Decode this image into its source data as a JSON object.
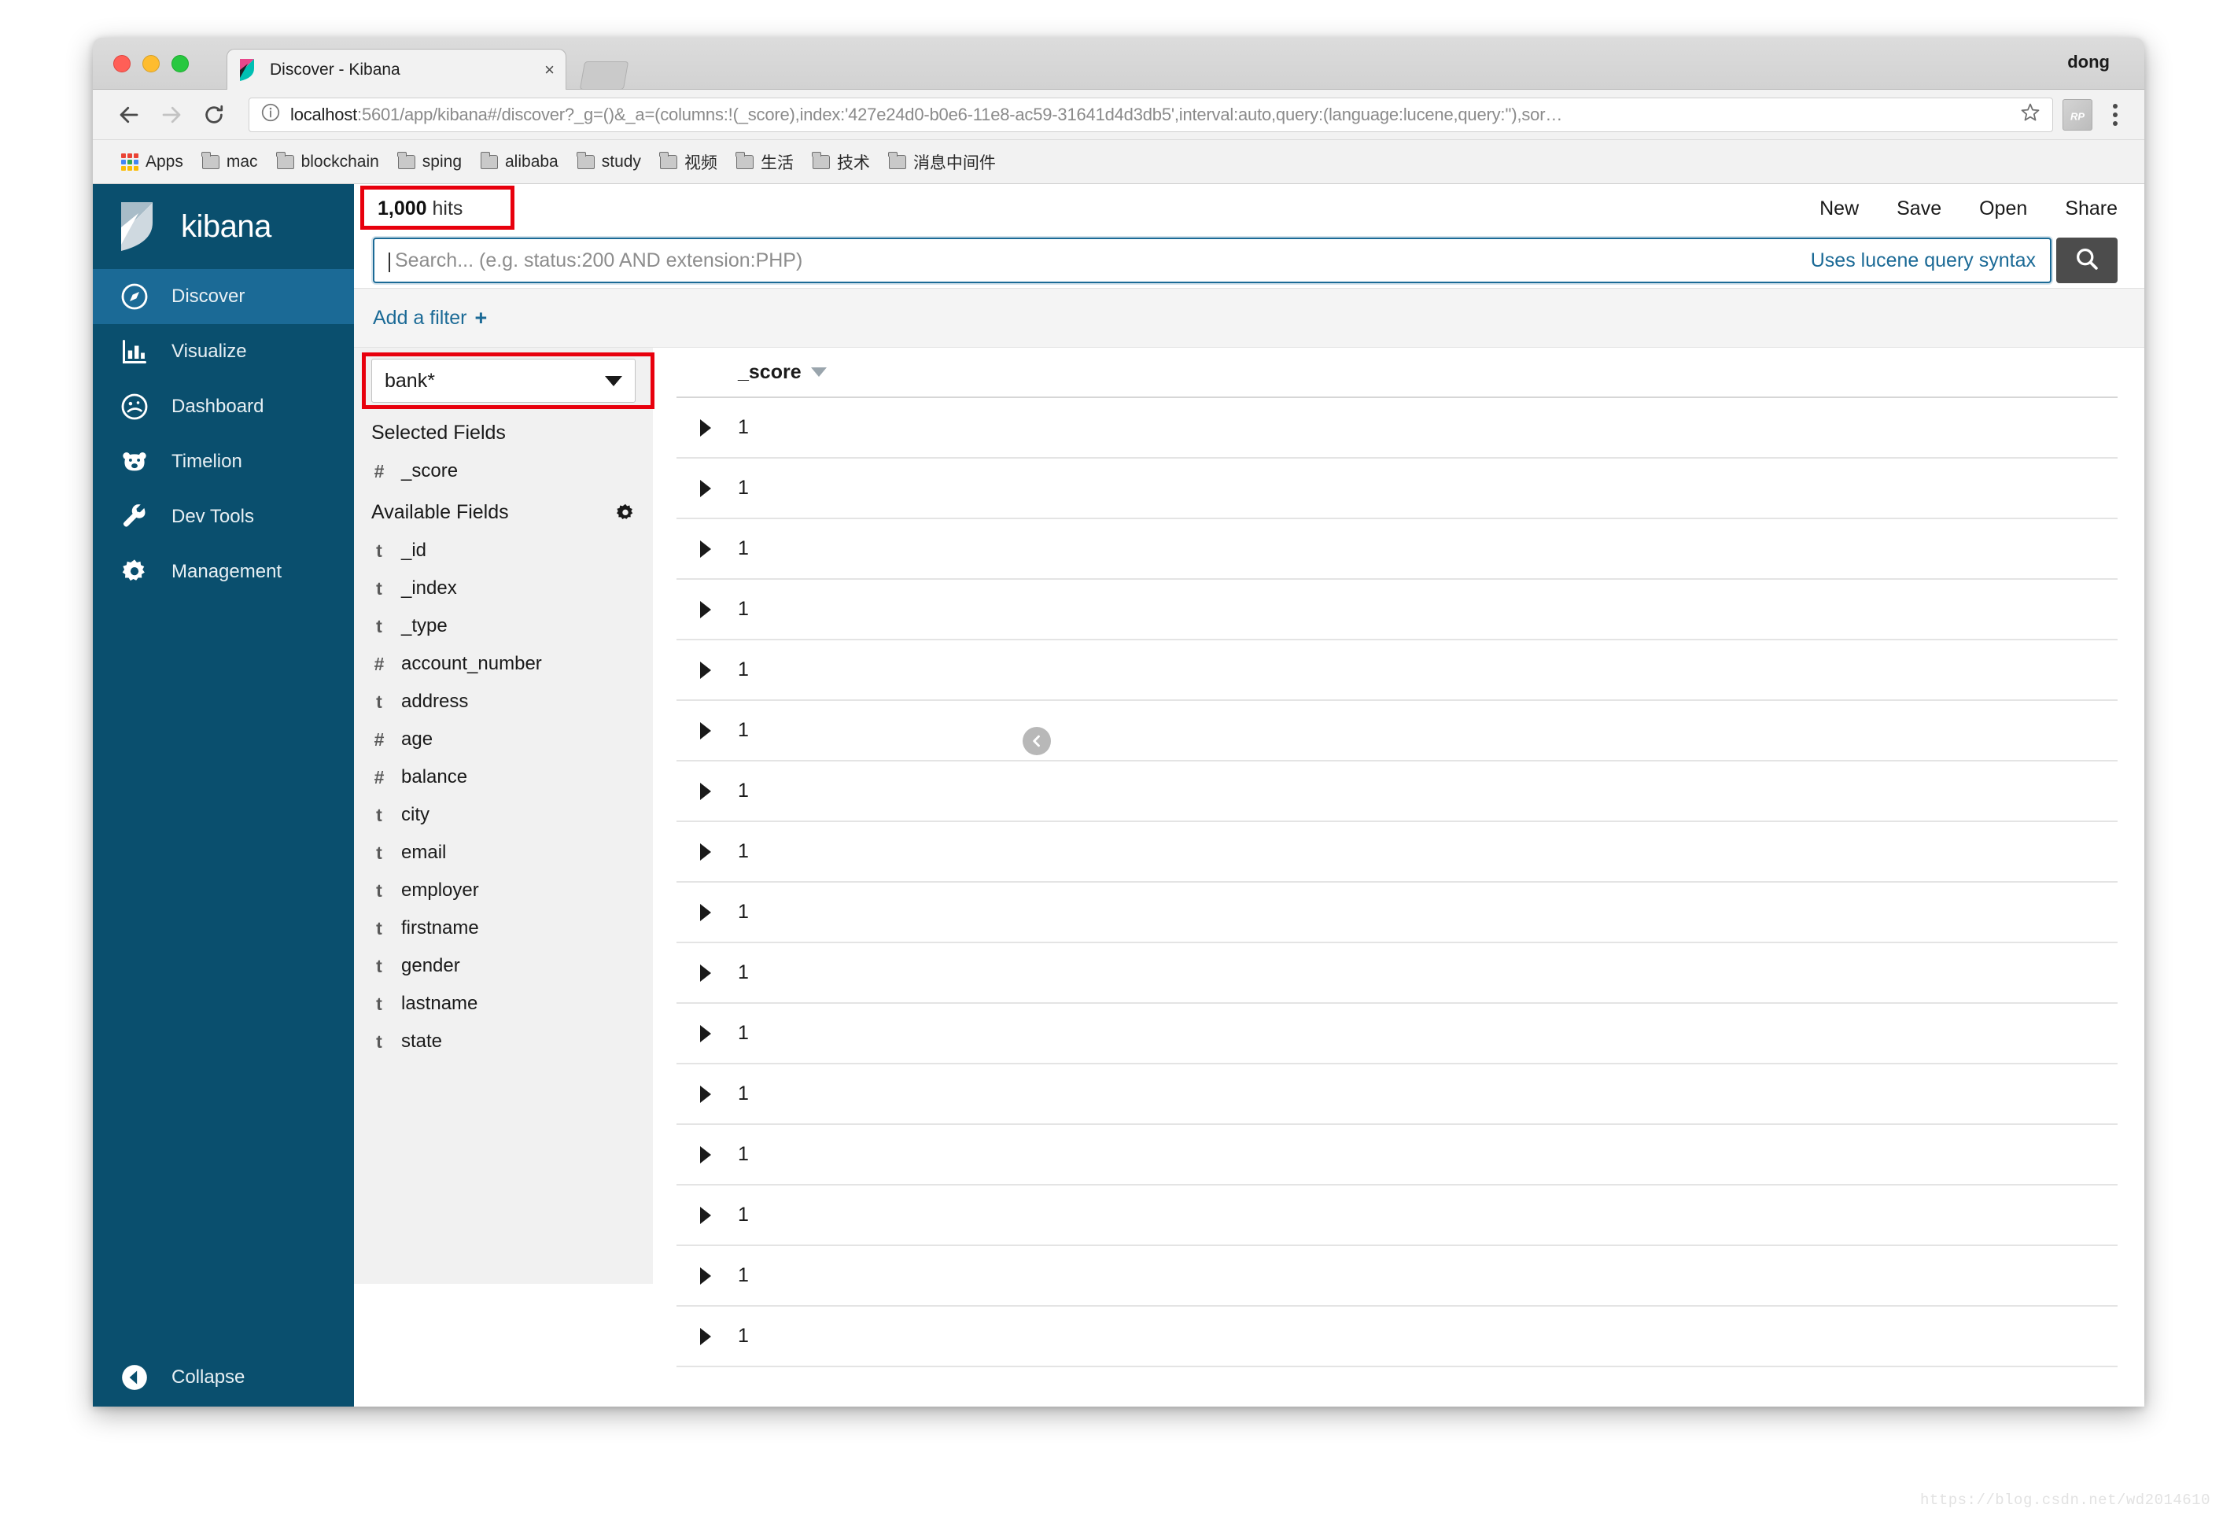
{
  "browser": {
    "tab": {
      "title": "Discover - Kibana",
      "close_label": "×",
      "favicon": "kibana-favicon"
    },
    "profile_name": "dong",
    "nav": {
      "back_label": "←",
      "forward_label": "→",
      "reload_label": "⟳"
    },
    "omnibox": {
      "info_icon": "info-circle-icon",
      "url_host": "localhost",
      "url_rest": ":5601/app/kibana#/discover?_g=()&_a=(columns:!(_score),index:'427e24d0-b0e6-11e8-ac59-31641d4d3db5',interval:auto,query:(language:lucene,query:''),sor…",
      "star_icon": "star-icon",
      "extension_icon": "extension-icon",
      "menu_icon": "kebab-menu-icon"
    },
    "bookmarks": [
      {
        "label": "Apps",
        "icon": "apps-grid-icon"
      },
      {
        "label": "mac",
        "icon": "folder-icon"
      },
      {
        "label": "blockchain",
        "icon": "folder-icon"
      },
      {
        "label": "sping",
        "icon": "folder-icon"
      },
      {
        "label": "alibaba",
        "icon": "folder-icon"
      },
      {
        "label": "study",
        "icon": "folder-icon"
      },
      {
        "label": "视频",
        "icon": "folder-icon"
      },
      {
        "label": "生活",
        "icon": "folder-icon"
      },
      {
        "label": "技术",
        "icon": "folder-icon"
      },
      {
        "label": "消息中间件",
        "icon": "folder-icon"
      }
    ]
  },
  "kibana": {
    "brand": "kibana",
    "nav_items": [
      {
        "label": "Discover",
        "icon": "compass-icon",
        "active": true
      },
      {
        "label": "Visualize",
        "icon": "bar-chart-icon",
        "active": false
      },
      {
        "label": "Dashboard",
        "icon": "dashboard-icon",
        "active": false
      },
      {
        "label": "Timelion",
        "icon": "bear-icon",
        "active": false
      },
      {
        "label": "Dev Tools",
        "icon": "wrench-icon",
        "active": false
      },
      {
        "label": "Management",
        "icon": "gear-icon",
        "active": false
      }
    ],
    "collapse": {
      "label": "Collapse",
      "icon": "arrow-left-circle-icon"
    },
    "topbar": {
      "hits_count": "1,000",
      "hits_suffix": "hits",
      "actions": [
        "New",
        "Save",
        "Open",
        "Share"
      ]
    },
    "query": {
      "placeholder": "Search... (e.g. status:200 AND extension:PHP)",
      "value": "",
      "hint": "Uses lucene query syntax",
      "search_icon": "search-icon"
    },
    "filterbar": {
      "add_filter_label": "Add a filter",
      "plus": "+"
    },
    "sidebar": {
      "index_pattern": "bank*",
      "collapse_handle_icon": "chevron-left-icon",
      "selected_fields_title": "Selected Fields",
      "selected_fields": [
        {
          "type": "#",
          "name": "_score"
        }
      ],
      "available_fields_title": "Available Fields",
      "available_gear_icon": "gear-icon",
      "available_fields": [
        {
          "type": "t",
          "name": "_id"
        },
        {
          "type": "t",
          "name": "_index"
        },
        {
          "type": "t",
          "name": "_type"
        },
        {
          "type": "#",
          "name": "account_number"
        },
        {
          "type": "t",
          "name": "address"
        },
        {
          "type": "#",
          "name": "age"
        },
        {
          "type": "#",
          "name": "balance"
        },
        {
          "type": "t",
          "name": "city"
        },
        {
          "type": "t",
          "name": "email"
        },
        {
          "type": "t",
          "name": "employer"
        },
        {
          "type": "t",
          "name": "firstname"
        },
        {
          "type": "t",
          "name": "gender"
        },
        {
          "type": "t",
          "name": "lastname"
        },
        {
          "type": "t",
          "name": "state"
        }
      ]
    },
    "doc_table": {
      "columns": [
        "_score"
      ],
      "sort_icon": "sort-desc-icon",
      "expand_icon": "expand-triangle-icon",
      "rows": [
        {
          "_score": "1"
        },
        {
          "_score": "1"
        },
        {
          "_score": "1"
        },
        {
          "_score": "1"
        },
        {
          "_score": "1"
        },
        {
          "_score": "1"
        },
        {
          "_score": "1"
        },
        {
          "_score": "1"
        },
        {
          "_score": "1"
        },
        {
          "_score": "1"
        },
        {
          "_score": "1"
        },
        {
          "_score": "1"
        },
        {
          "_score": "1"
        },
        {
          "_score": "1"
        },
        {
          "_score": "1"
        },
        {
          "_score": "1"
        }
      ]
    },
    "colors": {
      "nav_bg": "#0a4f6e",
      "nav_active": "#1b6a96",
      "accent": "#1b6a96",
      "highlight": "#e8000d"
    }
  },
  "watermark": "https://blog.csdn.net/wd2014610"
}
